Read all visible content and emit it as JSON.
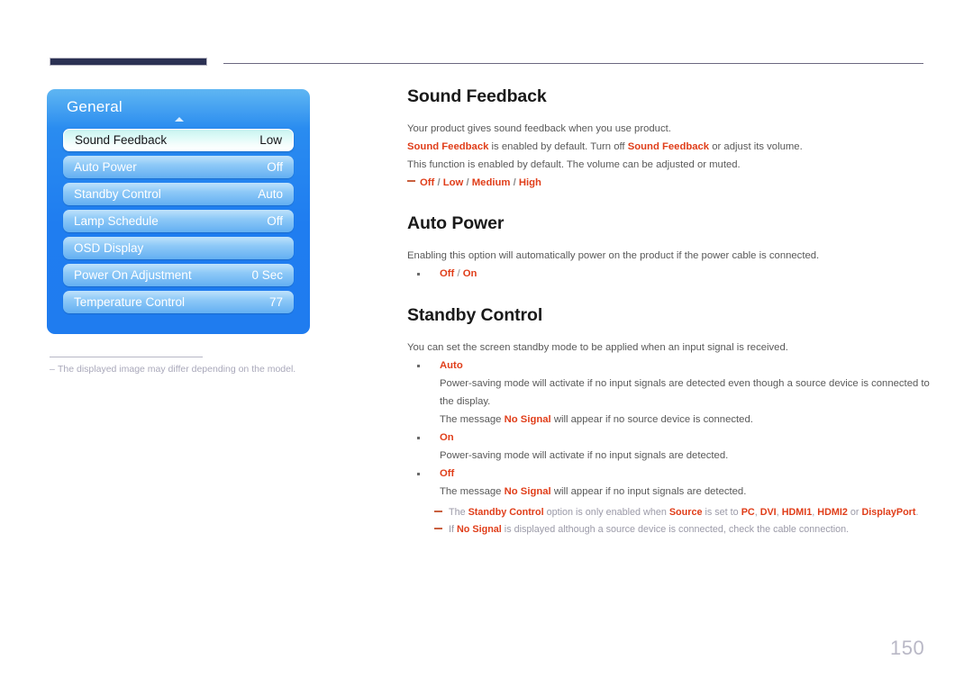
{
  "header": {
    "bar_color": "#2b3153",
    "rule_color": "#6b6880"
  },
  "osd_panel": {
    "title": "General",
    "rows": [
      {
        "label": "Sound Feedback",
        "value": "Low",
        "selected": true
      },
      {
        "label": "Auto Power",
        "value": "Off",
        "selected": false
      },
      {
        "label": "Standby Control",
        "value": "Auto",
        "selected": false
      },
      {
        "label": "Lamp Schedule",
        "value": "Off",
        "selected": false
      },
      {
        "label": "OSD Display",
        "value": "",
        "selected": false
      },
      {
        "label": "Power On Adjustment",
        "value": "0 Sec",
        "selected": false
      },
      {
        "label": "Temperature Control",
        "value": "77",
        "selected": false
      }
    ]
  },
  "left_note": {
    "dash": "‒",
    "text": "The displayed image may differ depending on the model."
  },
  "sections": {
    "sound_feedback": {
      "title": "Sound Feedback",
      "line1": "Your product gives sound feedback when you use product.",
      "line2_a": "Sound Feedback",
      "line2_b": " is enabled by default. Turn off ",
      "line2_c": "Sound Feedback",
      "line2_d": " or adjust its volume.",
      "line3": "This function is enabled by default. The volume can be adjusted or muted.",
      "options": {
        "opt1": "Off",
        "opt2": "Low",
        "opt3": "Medium",
        "opt4": "High",
        "sep": " / "
      }
    },
    "auto_power": {
      "title": "Auto Power",
      "line1": "Enabling this option will automatically power on the product if the power cable is connected.",
      "options": {
        "opt1": "Off",
        "opt2": "On",
        "sep": " / "
      }
    },
    "standby_control": {
      "title": "Standby Control",
      "line1": "You can set the screen standby mode to be applied when an input signal is received.",
      "auto": {
        "label": "Auto",
        "desc1": "Power-saving mode will activate if no input signals are detected even though a source device is connected to the display.",
        "desc2_a": "The message ",
        "desc2_b": "No Signal",
        "desc2_c": " will appear if no source device is connected."
      },
      "on": {
        "label": "On",
        "desc1": "Power-saving mode will activate if no input signals are detected."
      },
      "off": {
        "label": "Off",
        "desc1_a": "The message ",
        "desc1_b": "No Signal",
        "desc1_c": " will appear if no input signals are detected."
      },
      "notes": {
        "note1_a": "The ",
        "note1_b": "Standby Control",
        "note1_c": " option is only enabled when ",
        "note1_d": "Source",
        "note1_e": " is set to ",
        "note1_f": "PC",
        "note1_g": ", ",
        "note1_h": "DVI",
        "note1_i": ", ",
        "note1_j": "HDMI1",
        "note1_k": ", ",
        "note1_l": "HDMI2",
        "note1_m": " or ",
        "note1_n": "DisplayPort",
        "note1_o": ".",
        "note2_a": "If ",
        "note2_b": "No Signal",
        "note2_c": " is displayed although a source device is connected, check the cable connection."
      }
    }
  },
  "footer": {
    "page_number": "150"
  }
}
